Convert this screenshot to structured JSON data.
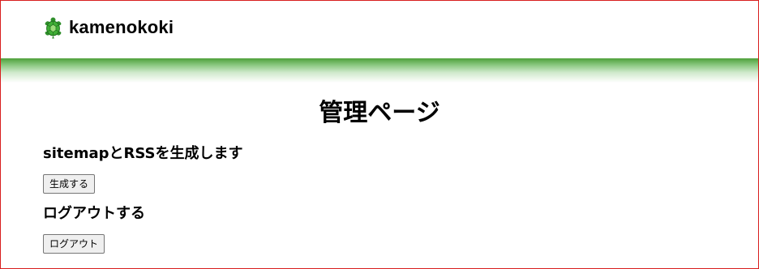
{
  "header": {
    "brand": "kamenokoki",
    "brand_icon": "turtle-icon",
    "accent": "#4ea03a"
  },
  "main": {
    "title": "管理ページ",
    "sitemap_heading": "sitemapとRSSを生成します",
    "generate_button": "生成する",
    "logout_heading": "ログアウトする",
    "logout_button": "ログアウト"
  },
  "colors": {
    "frame_border": "#d81e1e",
    "button_background": "#efefef",
    "button_border": "#767676"
  }
}
